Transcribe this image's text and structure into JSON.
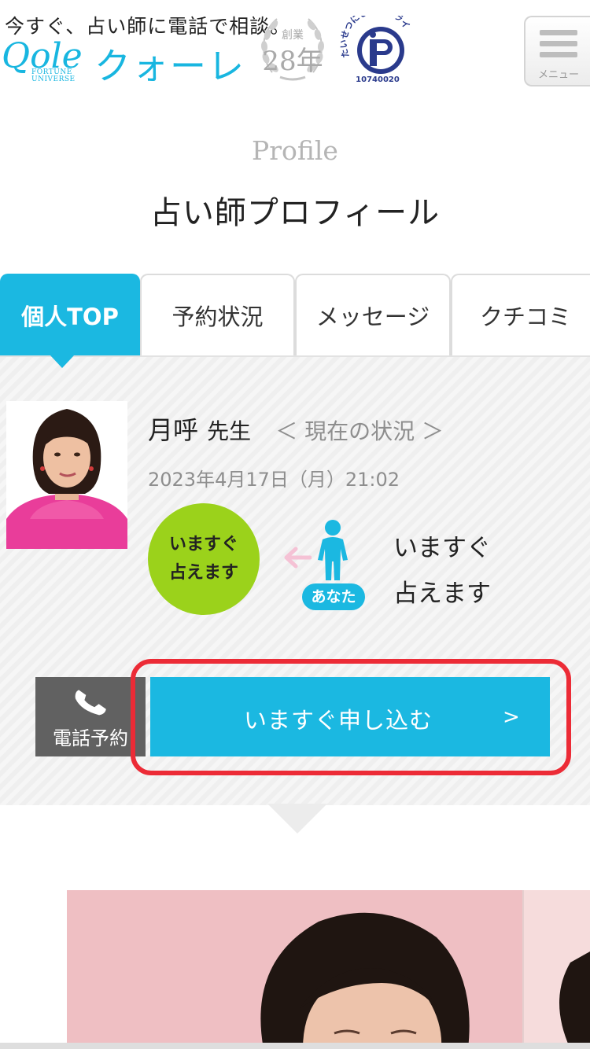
{
  "header": {
    "tagline": "今すぐ、占い師に電話で相談。",
    "logo_latin": "Qole",
    "logo_sub_line1": "FORTUNE",
    "logo_sub_line2": "UNIVERSE",
    "logo_kana": "クォーレ",
    "badge_founded": "創業",
    "badge_years": "28年",
    "privacy_mark_text": "たいせつにしますプライバシー",
    "privacy_mark_number": "10740020",
    "menu_label": "メニュー"
  },
  "page": {
    "subtitle": "Profile",
    "title": "占い師プロフィール"
  },
  "tabs": [
    {
      "label": "個人TOP",
      "active": true
    },
    {
      "label": "予約状況",
      "active": false
    },
    {
      "label": "メッセージ",
      "active": false
    },
    {
      "label": "クチコミ",
      "active": false
    }
  ],
  "profile": {
    "name": "月呼",
    "honorific": "先生",
    "status_link": "＜ 現在の状況 ＞",
    "datetime": "2023年4月17日（月）21:02",
    "circle_line1": "いますぐ",
    "circle_line2": "占えます",
    "you_badge": "あなた",
    "status_line1": "いますぐ",
    "status_line2": "占えます"
  },
  "actions": {
    "tel_reserve_label": "電話予約",
    "apply_now_label": "いますぐ申し込む",
    "apply_chevron": ">"
  },
  "colors": {
    "accent": "#1bb8e1",
    "available_green": "#9bd21b",
    "highlight_red": "#ec2b36",
    "tel_button": "#616161"
  },
  "icons": [
    "hamburger-menu-icon",
    "phone-icon",
    "person-icon",
    "left-arrow-icon"
  ]
}
